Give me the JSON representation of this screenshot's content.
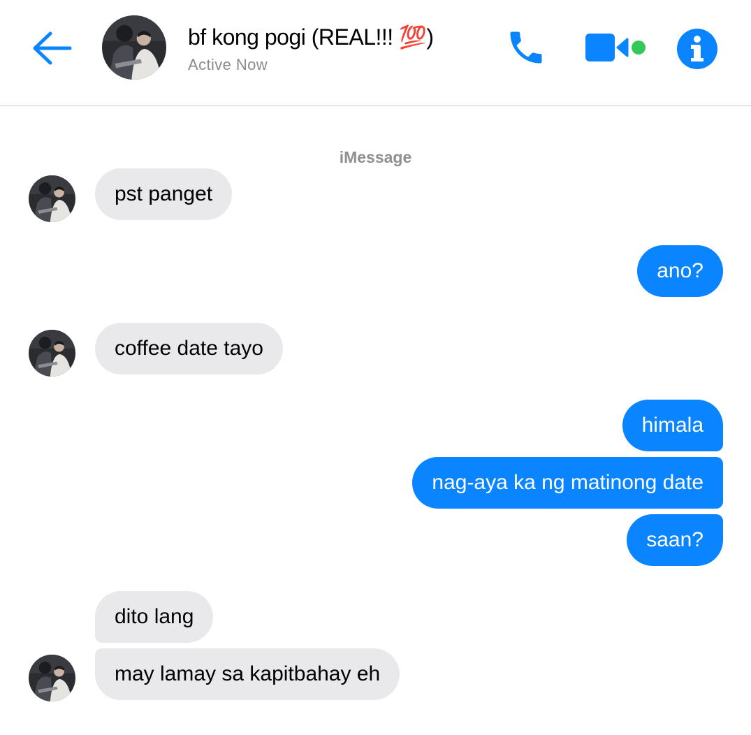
{
  "header": {
    "contact_name": "bf kong pogi (REAL!!! 💯)",
    "status": "Active Now"
  },
  "colors": {
    "accent": "#0a84ff",
    "incoming_bubble": "#e9e9eb",
    "active_dot": "#34c759"
  },
  "icons": [
    "back-arrow-icon",
    "phone-icon",
    "video-camera-icon",
    "info-icon"
  ],
  "thread": {
    "service_label": "iMessage",
    "messages": [
      {
        "direction": "in",
        "text": "pst panget"
      },
      {
        "direction": "out",
        "text": "ano?"
      },
      {
        "direction": "in",
        "text": "coffee date tayo"
      },
      {
        "direction": "out",
        "text": "himala"
      },
      {
        "direction": "out",
        "text": "nag-aya ka ng matinong date"
      },
      {
        "direction": "out",
        "text": "saan?"
      },
      {
        "direction": "in",
        "text": "dito lang"
      },
      {
        "direction": "in",
        "text": "may lamay sa kapitbahay eh"
      }
    ]
  }
}
